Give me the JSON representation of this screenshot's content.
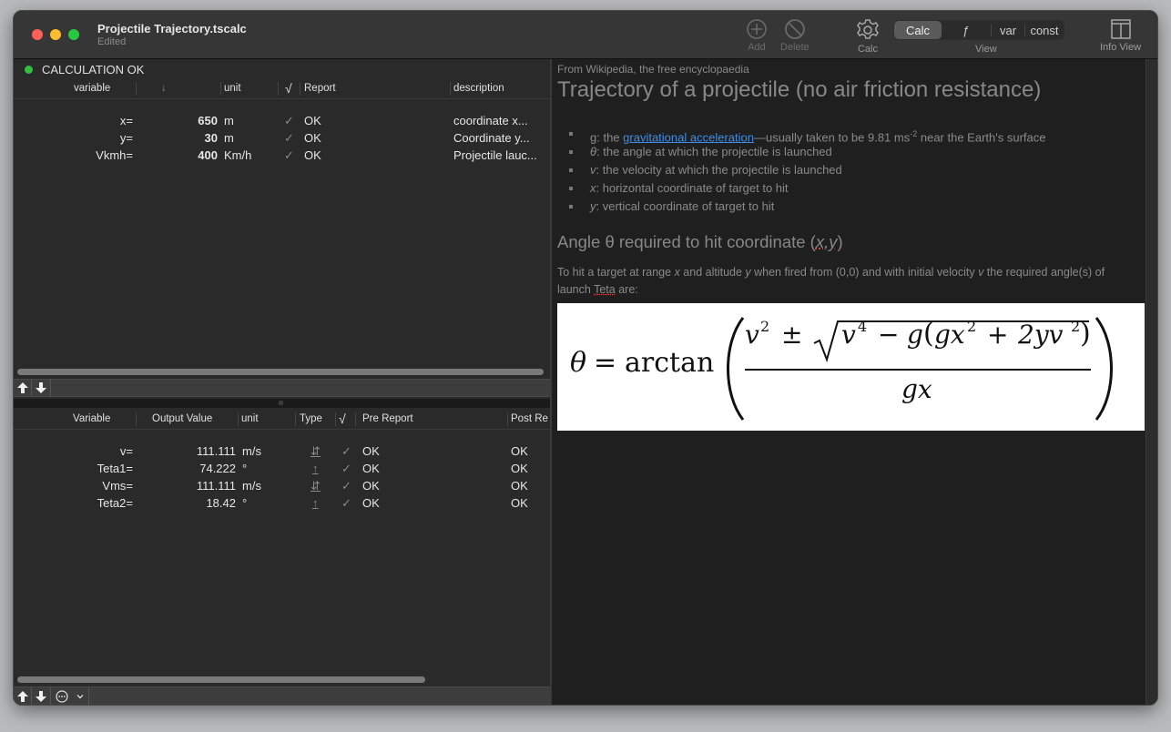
{
  "window": {
    "title": "Projectile Trajectory.tscalc",
    "subtitle": "Edited"
  },
  "toolbar": {
    "add_label": "Add",
    "delete_label": "Delete",
    "calc_label": "Calc",
    "view_label": "View",
    "info_view_label": "Info View",
    "view_segments": [
      {
        "label": "Calc",
        "active": true
      },
      {
        "label": "ƒ",
        "active": false
      },
      {
        "label": "var",
        "active": false
      },
      {
        "label": "const",
        "active": false
      }
    ]
  },
  "status": {
    "text": "CALCULATION OK",
    "color": "#30c23c"
  },
  "input_table": {
    "headers": {
      "variable": "variable",
      "value": "↓",
      "unit": "unit",
      "check": "√",
      "report": "Report",
      "description": "description"
    },
    "rows": [
      {
        "variable": "x=",
        "value": "650",
        "unit": "m",
        "check": "✓",
        "report": "OK",
        "description": "coordinate x..."
      },
      {
        "variable": "y=",
        "value": "30",
        "unit": "m",
        "check": "✓",
        "report": "OK",
        "description": "Coordinate y..."
      },
      {
        "variable": "Vkmh=",
        "value": "400",
        "unit": "Km/h",
        "check": "✓",
        "report": "OK",
        "description": "Projectile lauc..."
      }
    ]
  },
  "output_table": {
    "headers": {
      "variable": "Variable",
      "output_value": "Output Value",
      "unit": "unit",
      "type": "Type",
      "check": "√",
      "pre_report": "Pre Report",
      "post_report": "Post Re"
    },
    "rows": [
      {
        "variable": "v=",
        "value": "111.111",
        "unit": "m/s",
        "type": "⇵",
        "check": "✓",
        "pre_report": "OK",
        "post_report": "OK"
      },
      {
        "variable": "Teta1=",
        "value": "74.222",
        "unit": "°",
        "type": "↑",
        "check": "✓",
        "pre_report": "OK",
        "post_report": "OK"
      },
      {
        "variable": "Vms=",
        "value": "111.111",
        "unit": "m/s",
        "type": "⇵",
        "check": "✓",
        "pre_report": "OK",
        "post_report": "OK"
      },
      {
        "variable": "Teta2=",
        "value": "18.42",
        "unit": "°",
        "type": "↑",
        "check": "✓",
        "pre_report": "OK",
        "post_report": "OK"
      }
    ]
  },
  "bottom_bar": {
    "up": "🡅",
    "down": "🡇",
    "more": "⋯",
    "chevron": "⌄"
  },
  "info": {
    "source": "From Wikipedia, the free encyclopaedia",
    "title": "Trajectory of a projectile (no air friction resistance)",
    "bullets": [
      {
        "var": "g",
        "pre": ": the ",
        "link": "gravitational acceleration",
        "post": "—usually taken to be 9.81 ms",
        "sup": "-2",
        "tail": " near the Earth's surface"
      },
      {
        "var": "θ",
        "text": ": the angle at which the projectile is launched"
      },
      {
        "var": "v",
        "text": ": the velocity at which the projectile is launched"
      },
      {
        "var": "x",
        "text": ": horizontal coordinate of target to hit"
      },
      {
        "var": "y",
        "text": ": vertical coordinate of target to hit"
      }
    ],
    "subheading_pre": "Angle θ required to hit coordinate (",
    "subheading_xy": "x,y",
    "subheading_post": ")",
    "paragraph": {
      "p1": "To hit a target at range ",
      "x": "x",
      "p2": " and altitude ",
      "y": "y",
      "p3": " when fired from (0,0) and with initial velocity ",
      "v": "v",
      "p4": " the required angle(s) of launch ",
      "teta": "Teta",
      "p5": " are:"
    },
    "formula": {
      "lhs": "θ",
      "eq": "=",
      "fn": "arctan",
      "numerator_a": "v",
      "sup2": "2",
      "pm": "±",
      "rad_v": "v",
      "sup4": "4",
      "minus": "−",
      "g1": "g",
      "open": "(",
      "gx": "gx",
      "plus": "+",
      "two_y_v": "2yv",
      "close": ")",
      "denominator": "gx"
    }
  }
}
